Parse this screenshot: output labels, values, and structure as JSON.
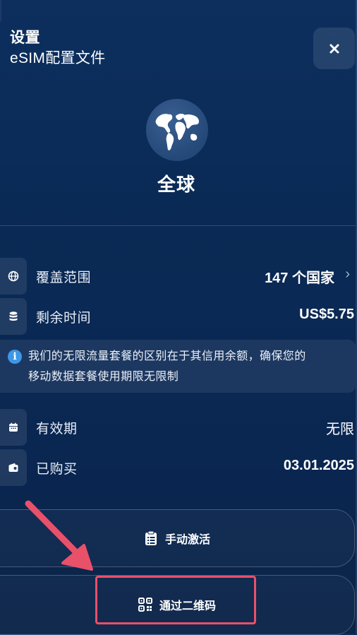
{
  "header": {
    "title": "设置",
    "subtitle": "eSIM配置文件",
    "close_icon": "close-icon"
  },
  "region": {
    "name": "全球",
    "icon": "globe-icon"
  },
  "details": {
    "coverage": {
      "label": "覆盖范围",
      "value": "147 个国家",
      "icon": "globe-small-icon",
      "chevron": "›"
    },
    "remaining": {
      "label": "剩余时间",
      "value": "US$5.75",
      "icon": "database-icon"
    },
    "info": {
      "text_line1": "我们的无限流量套餐的区别在于其信用余额，确保您的",
      "text_line2": "移动数据套餐使用期限无限制",
      "icon": "info-icon"
    },
    "validity": {
      "label": "有效期",
      "value": "无限",
      "icon": "calendar-icon"
    },
    "purchased": {
      "label": "已购买",
      "value": "03.01.2025",
      "icon": "wallet-icon"
    }
  },
  "actions": {
    "manual": {
      "label": "手动激活",
      "icon": "clipboard-icon"
    },
    "qr": {
      "label": "通过二维码",
      "icon": "qr-code-icon"
    }
  },
  "colors": {
    "background": "#0a2a55",
    "annotation": "#e9506a",
    "info_accent": "#3d97e6"
  }
}
